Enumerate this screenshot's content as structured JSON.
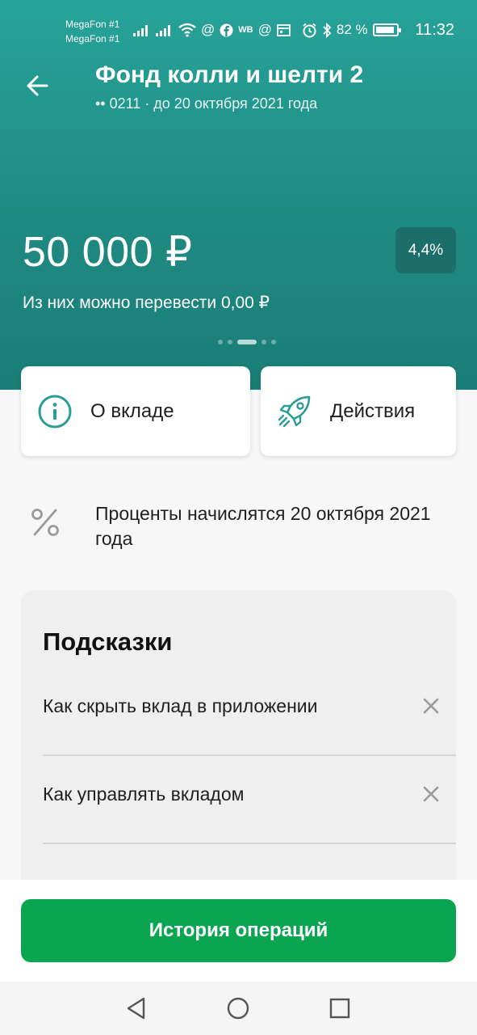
{
  "status_bar": {
    "carrier1": "MegaFon #1",
    "carrier2": "MegaFon #1",
    "wb_label": "WB",
    "battery": "82 %",
    "time": "11:32"
  },
  "header": {
    "title": "Фонд колли и шелти 2",
    "subtitle": "•• 0211 · до 20 октября 2021 года",
    "amount": "50 000 ₽",
    "rate": "4,4%",
    "transfer_text": "Из них можно перевести 0,00 ₽",
    "pager": {
      "pages": 5,
      "active": 2
    }
  },
  "actions": {
    "about_label": "О вкладе",
    "actions_label": "Действия"
  },
  "interest_info": {
    "text": "Проценты начислятся 20 октября 2021 года"
  },
  "hints": {
    "title": "Подсказки",
    "items": [
      {
        "label": "Как скрыть вклад в приложении"
      },
      {
        "label": "Как управлять вкладом"
      }
    ]
  },
  "bottom": {
    "history_button": "История операций"
  },
  "colors": {
    "header_teal": "#27a39a",
    "accent_teal": "#2a9d94",
    "primary_green": "#0aa550",
    "rate_badge": "#1b6e69"
  },
  "icons": {
    "back": "arrow-left-icon",
    "info": "info-circle-icon",
    "actions": "rocket-icon",
    "percent": "percent-icon",
    "close": "close-icon",
    "nav_back": "triangle-back-icon",
    "nav_home": "circle-home-icon",
    "nav_recent": "square-recent-icon"
  }
}
